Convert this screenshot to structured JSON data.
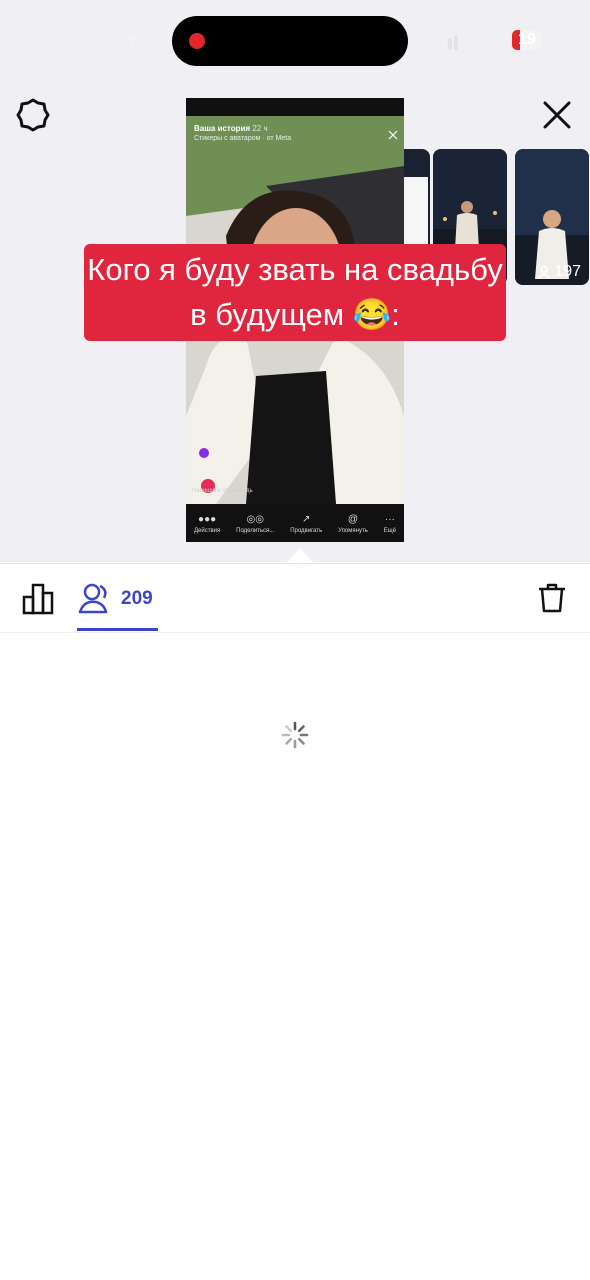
{
  "status_bar": {
    "battery_level": "19",
    "recording": true,
    "icons": [
      "location-arrow-icon",
      "signal-icon",
      "wifi-icon",
      "battery-icon"
    ]
  },
  "toolbar": {
    "settings_icon": "gear-icon",
    "close_icon": "close-icon"
  },
  "story": {
    "header_title": "Ваша история",
    "header_time": "22 ч",
    "header_subtitle": "Стикеры с аватаром · от Meta",
    "reply_placeholder": "Напишите что-нибудь",
    "actions": [
      {
        "icon": "avatars-icon",
        "label": "Действия"
      },
      {
        "icon": "share-icon",
        "label": "Поделиться..."
      },
      {
        "icon": "trending-icon",
        "label": "Продвигать"
      },
      {
        "icon": "at-icon",
        "label": "Упомянуть"
      },
      {
        "icon": "more-icon",
        "label": "Ещё"
      }
    ]
  },
  "thumbnails": [
    {
      "views": ""
    },
    {
      "views": ""
    },
    {
      "views": "197"
    }
  ],
  "caption": {
    "text": "Кого я буду звать на свадьбу в будущем 😂:"
  },
  "tabs": {
    "viewers_count": "209"
  },
  "colors": {
    "accent": "#3c46c8",
    "caption_bg": "#e0263f",
    "header_bg": "#efeff4"
  }
}
